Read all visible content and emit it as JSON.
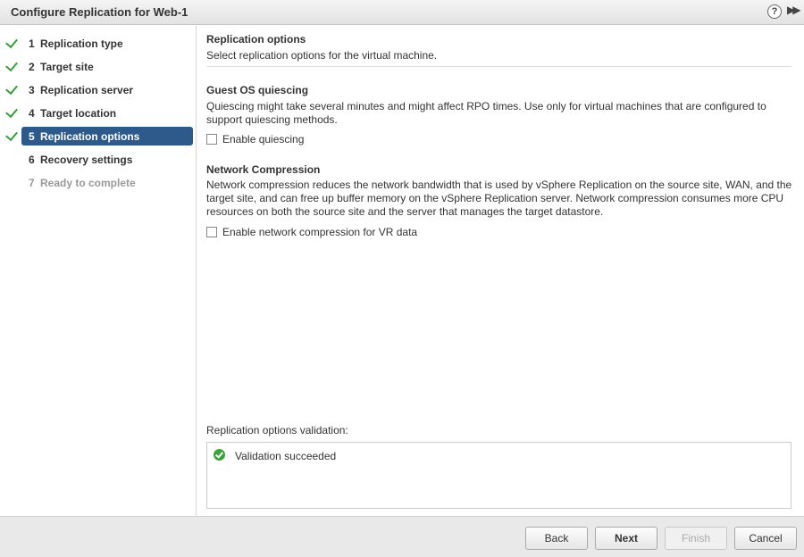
{
  "window": {
    "title": "Configure Replication for Web-1",
    "help_glyph": "?",
    "expand_glyph": "▶▶"
  },
  "steps": [
    {
      "num": "1",
      "label": "Replication type",
      "state": "done"
    },
    {
      "num": "2",
      "label": "Target site",
      "state": "done"
    },
    {
      "num": "3",
      "label": "Replication server",
      "state": "done"
    },
    {
      "num": "4",
      "label": "Target location",
      "state": "done"
    },
    {
      "num": "5",
      "label": "Replication options",
      "state": "active"
    },
    {
      "num": "6",
      "label": "Recovery settings",
      "state": "pending"
    },
    {
      "num": "7",
      "label": "Ready to complete",
      "state": "disabled"
    }
  ],
  "main": {
    "title": "Replication options",
    "subtitle": "Select replication options for the virtual machine.",
    "quiescing": {
      "heading": "Guest OS quiescing",
      "description": "Quiescing might take several minutes and might affect RPO times. Use only for virtual machines that are configured to support quiescing methods.",
      "checkbox_label": "Enable quiescing",
      "checked": false
    },
    "compression": {
      "heading": "Network Compression",
      "description": "Network compression reduces the network bandwidth that is used by vSphere Replication on the source site, WAN, and the target site, and can free up buffer memory on the vSphere Replication server. Network compression consumes more CPU resources on both the source site and the server that manages the target datastore.",
      "checkbox_label": "Enable network compression for VR data",
      "checked": false
    },
    "validation": {
      "label": "Replication options validation:",
      "status": "Validation succeeded"
    }
  },
  "footer": {
    "back": "Back",
    "next": "Next",
    "finish": "Finish",
    "cancel": "Cancel"
  },
  "colors": {
    "active_step": "#2e5a8b",
    "check": "#3a9b3a",
    "success": "#3aa33a"
  }
}
